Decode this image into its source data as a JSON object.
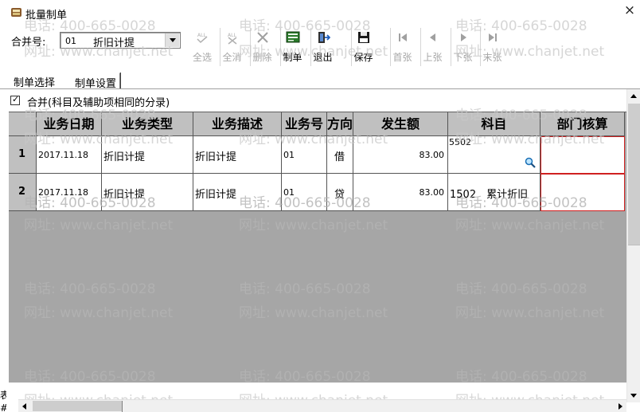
{
  "window": {
    "title": "批量制单",
    "close_glyph": "×"
  },
  "toolbar": {
    "merge_label": "合并号:",
    "merge_code": "01",
    "merge_name": "折旧计提",
    "buttons": [
      {
        "label": "全选",
        "icon": "select-all-icon",
        "enabled": false
      },
      {
        "label": "全消",
        "icon": "deselect-all-icon",
        "enabled": false
      },
      {
        "label": "删除",
        "icon": "delete-icon",
        "enabled": false
      },
      {
        "label": "制单",
        "icon": "make-voucher-icon",
        "enabled": true
      },
      {
        "label": "退出",
        "icon": "exit-icon",
        "enabled": true
      },
      {
        "label": "保存",
        "icon": "save-icon",
        "enabled": true
      },
      {
        "label": "首张",
        "icon": "first-record-icon",
        "enabled": false
      },
      {
        "label": "上张",
        "icon": "previous-record-icon",
        "enabled": false
      },
      {
        "label": "下张",
        "icon": "next-record-icon",
        "enabled": false
      },
      {
        "label": "末张",
        "icon": "last-record-icon",
        "enabled": false
      }
    ]
  },
  "tabs": [
    {
      "label": "制单选择",
      "active": false
    },
    {
      "label": "制单设置",
      "active": true
    }
  ],
  "merge_option": {
    "label": "合并(科目及辅助项相同的分录)",
    "checked": true
  },
  "grid": {
    "columns": [
      "",
      "业务日期",
      "业务类型",
      "业务描述",
      "业务号",
      "方向",
      "发生额",
      "科目",
      "部门核算"
    ],
    "rows": [
      {
        "no": "1",
        "date": "2017.11.18",
        "type": "折旧计提",
        "desc": "折旧计提",
        "biz_no": "01",
        "dir": "借",
        "amount": "83.00",
        "subject": "5502",
        "dept": ""
      },
      {
        "no": "2",
        "date": "2017.11.18",
        "type": "折旧计提",
        "desc": "折旧计提",
        "biz_no": "01",
        "dir": "贷",
        "amount": "83.00",
        "subject": "1502　累计折旧",
        "dept": ""
      }
    ]
  },
  "watermark": {
    "phone": "电话: 400-665-0028",
    "site": "网址: www.chanjet.net"
  },
  "edge_chars": {
    "a": "表",
    "b": "#"
  },
  "colors": {
    "grid_bg": "#a6a6a6",
    "header_bg": "#c0c0c0",
    "dept_border": "#d02020",
    "disabled_text": "#a7a7a7"
  }
}
